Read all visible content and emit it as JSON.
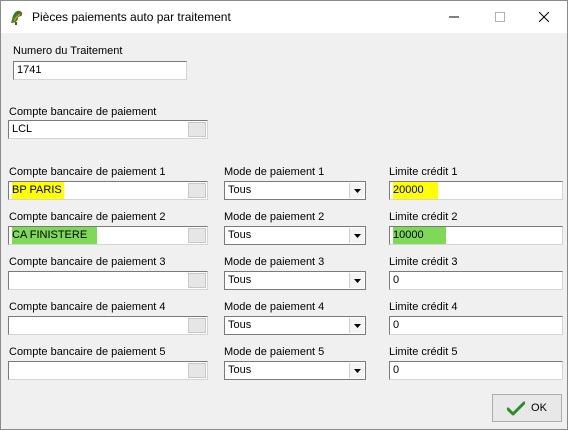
{
  "window": {
    "title": "Pièces paiements auto par traitement",
    "app_icon": "tree-dragon-icon",
    "controls": [
      "minimize-icon",
      "maximize-icon",
      "close-icon"
    ]
  },
  "traitement": {
    "label": "Numero du Traitement",
    "value": "1741"
  },
  "compte_principal": {
    "label": "Compte bancaire de paiement",
    "value": "LCL"
  },
  "rows": [
    {
      "compte_label": "Compte bancaire de paiement 1",
      "compte_value": "BP PARIS",
      "mode_label": "Mode de paiement 1",
      "mode_value": "Tous",
      "limite_label": "Limite crédit 1",
      "limite_value": "20000"
    },
    {
      "compte_label": "Compte bancaire de paiement 2",
      "compte_value": "CA FINISTERE",
      "mode_label": "Mode de paiement 2",
      "mode_value": "Tous",
      "limite_label": "Limite crédit 2",
      "limite_value": "10000"
    },
    {
      "compte_label": "Compte bancaire de paiement 3",
      "compte_value": "",
      "mode_label": "Mode de paiement 3",
      "mode_value": "Tous",
      "limite_label": "Limite crédit 3",
      "limite_value": "0"
    },
    {
      "compte_label": "Compte bancaire de paiement 4",
      "compte_value": "",
      "mode_label": "Mode de paiement 4",
      "mode_value": "Tous",
      "limite_label": "Limite crédit 4",
      "limite_value": "0"
    },
    {
      "compte_label": "Compte bancaire de paiement 5",
      "compte_value": "",
      "mode_label": "Mode de paiement 5",
      "mode_value": "Tous",
      "limite_label": "Limite crédit 5",
      "limite_value": "0"
    }
  ],
  "highlights": {
    "yellow": "#ffff00",
    "green": "#7ed957"
  },
  "ok_button": {
    "label": "OK",
    "icon": "checkmark-icon",
    "icon_color": "#2e8b2e"
  }
}
